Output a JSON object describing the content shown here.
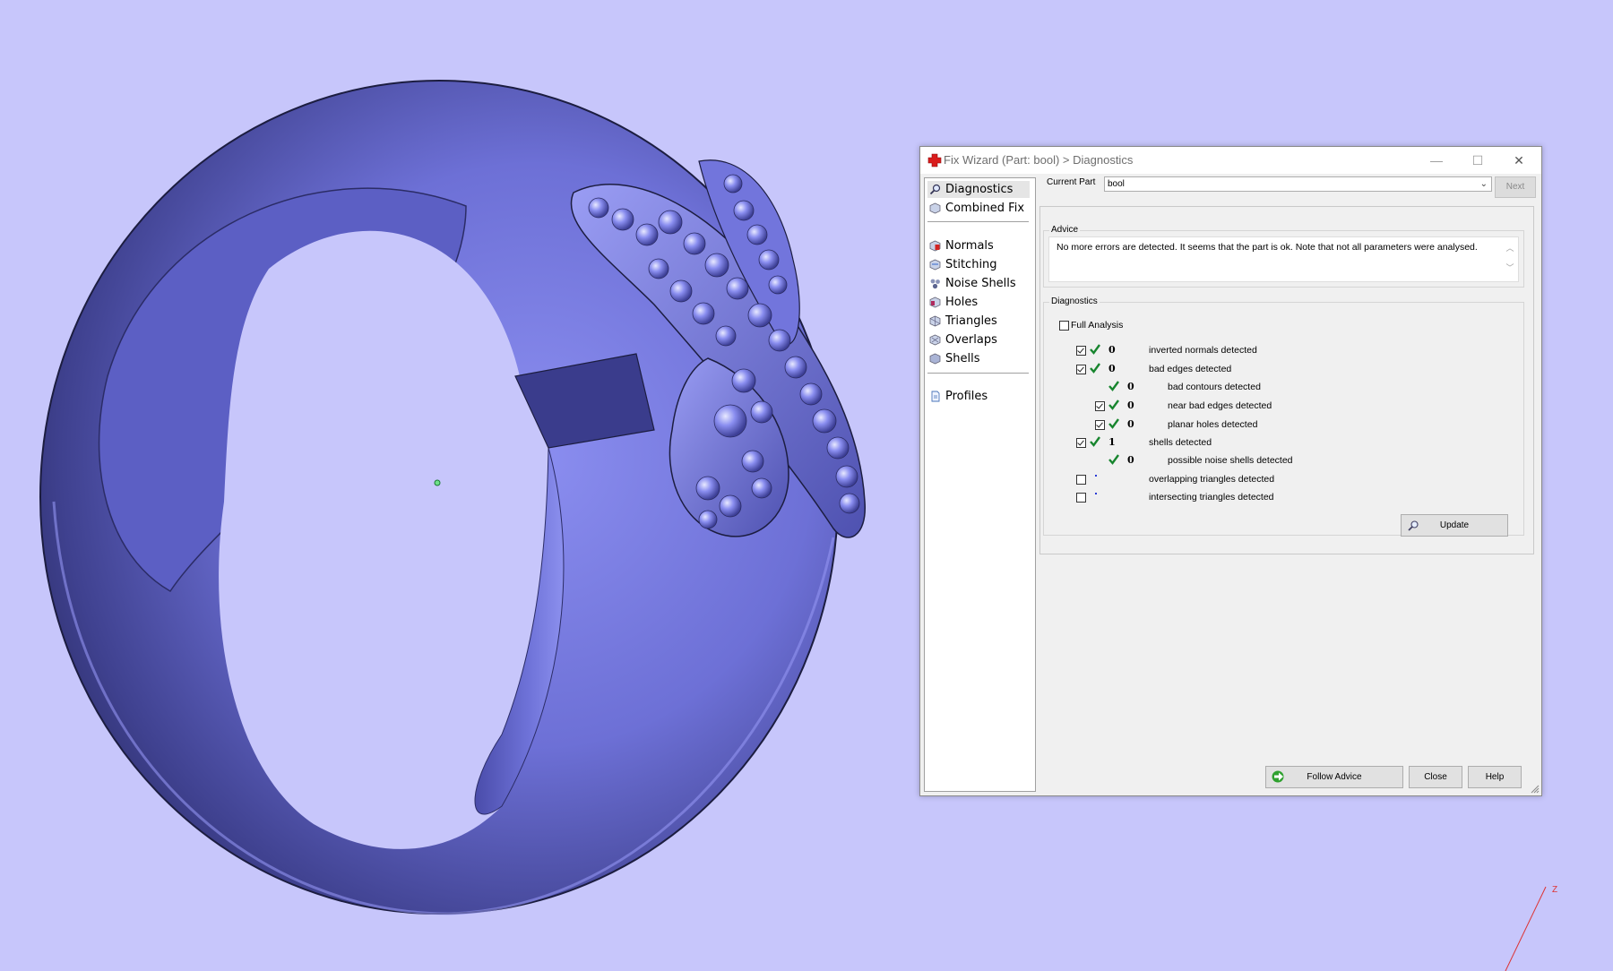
{
  "viewport": {
    "background": "#c7c6fb",
    "model_color": "#7b7ee2",
    "axis_label": "Z"
  },
  "dialog": {
    "title": "Fix Wizard (Part: bool) > Diagnostics",
    "title_icon": "red-cross-icon",
    "window_buttons": {
      "minimize": "—",
      "maximize": "☐",
      "close": "✕"
    },
    "nav": {
      "items": [
        {
          "label": "Diagnostics",
          "icon": "magnifier-icon",
          "active": true
        },
        {
          "label": "Combined Fix",
          "icon": "cube-icon"
        }
      ],
      "fix_items": [
        {
          "label": "Normals",
          "icon": "normals-cube-icon"
        },
        {
          "label": "Stitching",
          "icon": "stitching-cube-icon"
        },
        {
          "label": "Noise Shells",
          "icon": "noise-shells-icon"
        },
        {
          "label": "Holes",
          "icon": "holes-cube-icon"
        },
        {
          "label": "Triangles",
          "icon": "triangles-cube-icon"
        },
        {
          "label": "Overlaps",
          "icon": "overlaps-cube-icon"
        },
        {
          "label": "Shells",
          "icon": "shells-cube-icon"
        }
      ],
      "extra_items": [
        {
          "label": "Profiles",
          "icon": "profile-document-icon"
        }
      ]
    },
    "current_part": {
      "label": "Current Part",
      "value": "bool"
    },
    "next_button": "Next",
    "advice": {
      "title": "Advice",
      "text": "No more errors are detected. It seems that the part is ok. Note that not all parameters were analysed."
    },
    "diagnostics": {
      "title": "Diagnostics",
      "full_analysis": {
        "label": "Full Analysis",
        "checked": false
      },
      "rows": [
        {
          "checked": true,
          "has_checkbox": true,
          "status": "ok",
          "count": "0",
          "label": "inverted normals detected",
          "indent": 0
        },
        {
          "checked": true,
          "has_checkbox": true,
          "status": "ok",
          "count": "0",
          "label": "bad edges detected",
          "indent": 0
        },
        {
          "checked": false,
          "has_checkbox": false,
          "status": "ok",
          "count": "0",
          "label": "bad contours detected",
          "indent": 1
        },
        {
          "checked": true,
          "has_checkbox": true,
          "status": "ok",
          "count": "0",
          "label": "near bad edges detected",
          "indent": 1
        },
        {
          "checked": true,
          "has_checkbox": true,
          "status": "ok",
          "count": "0",
          "label": "planar holes detected",
          "indent": 1
        },
        {
          "checked": true,
          "has_checkbox": true,
          "status": "ok",
          "count": "1",
          "label": "shells detected",
          "indent": 0
        },
        {
          "checked": false,
          "has_checkbox": false,
          "status": "ok",
          "count": "0",
          "label": "possible noise shells detected",
          "indent": 1
        },
        {
          "checked": false,
          "has_checkbox": true,
          "status": "pending",
          "count": "",
          "label": "overlapping triangles detected",
          "indent": 0
        },
        {
          "checked": false,
          "has_checkbox": true,
          "status": "pending",
          "count": "",
          "label": "intersecting triangles detected",
          "indent": 0
        }
      ],
      "update_button": "Update"
    },
    "footer": {
      "follow_advice": "Follow Advice",
      "close": "Close",
      "help": "Help"
    }
  }
}
